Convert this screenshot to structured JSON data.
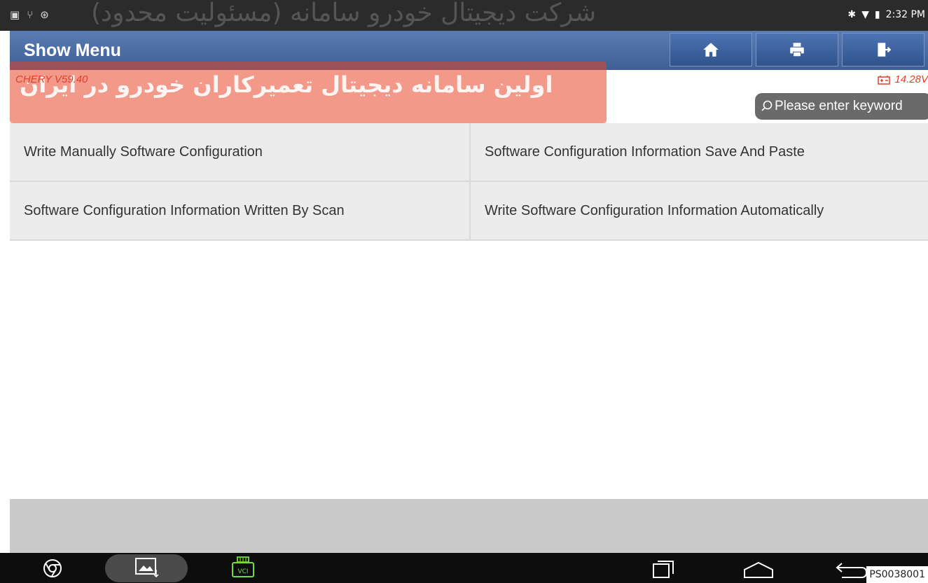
{
  "status": {
    "time": "2:32 PM",
    "left_icons": [
      "screenshot-icon",
      "usb-icon",
      "bluetooth-circle-icon"
    ]
  },
  "watermark": {
    "top": "شرکت دیجیتال خودرو سامانه (مسئولیت محدود)",
    "banner": "اولین سامانه دیجیتال تعمیرکاران خودرو در ایران"
  },
  "header": {
    "title": "Show Menu",
    "buttons": [
      "home-icon",
      "print-icon",
      "exit-icon"
    ]
  },
  "info": {
    "version": "CHERY V59.40",
    "voltage": "14.28V"
  },
  "search": {
    "placeholder": "Please enter keyword"
  },
  "menu": {
    "items": [
      "Write Manually Software Configuration",
      "Software Configuration Information Save And Paste",
      "Software Configuration Information Written By Scan",
      "Write Software Configuration Information Automatically"
    ]
  },
  "nav": {
    "vci_label": "VCI"
  },
  "figure_code": "PS0038001",
  "colors": {
    "title_bar": "#4a6ca6",
    "accent_red": "#e0412a",
    "menu_bg": "#ececec"
  }
}
